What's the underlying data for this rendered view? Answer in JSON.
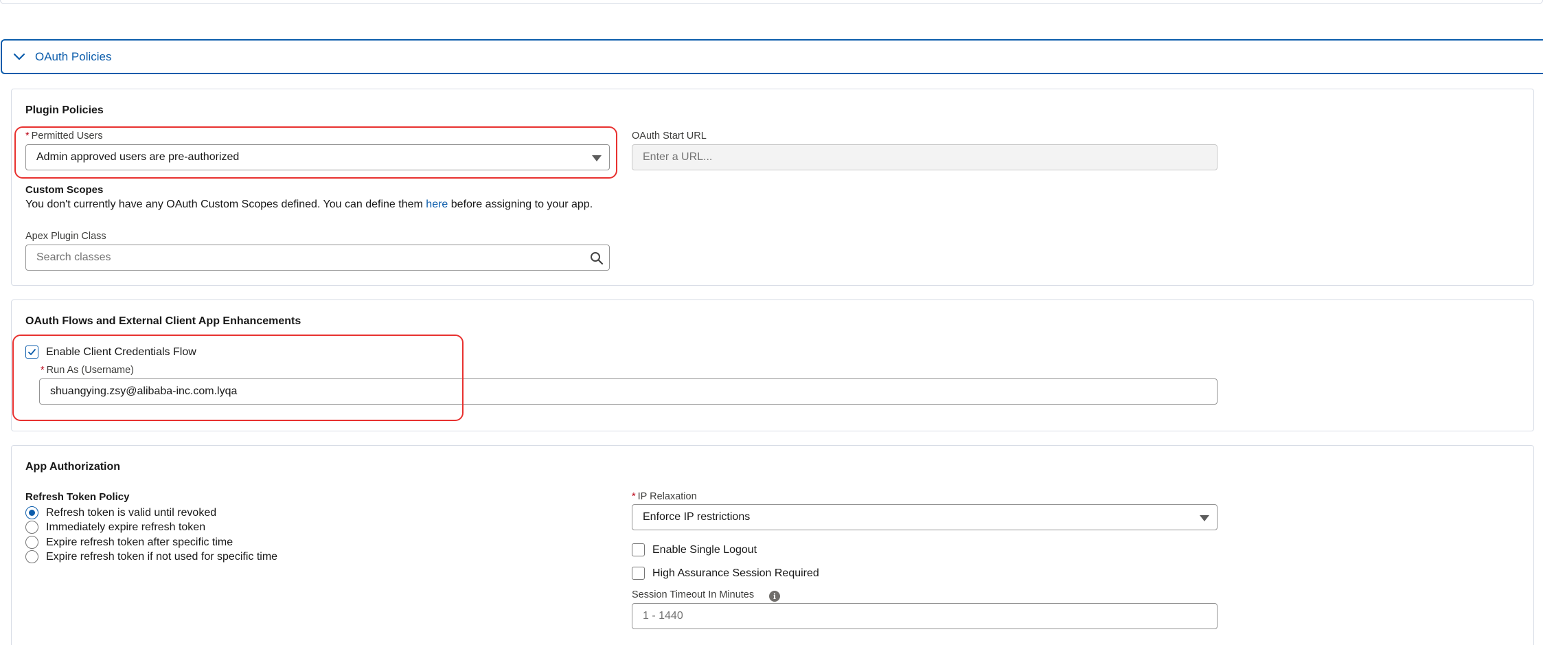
{
  "section": {
    "title": "OAuth Policies"
  },
  "plugin_policies": {
    "title": "Plugin Policies",
    "permitted_users": {
      "label": "Permitted Users",
      "value": "Admin approved users are pre-authorized"
    },
    "oauth_start_url": {
      "label": "OAuth Start URL",
      "placeholder": "Enter a URL..."
    },
    "custom_scopes": {
      "heading": "Custom Scopes",
      "text_before": "You don't currently have any OAuth Custom Scopes defined. You can define them ",
      "link": "here",
      "text_after": " before assigning to your app."
    },
    "apex_plugin_class": {
      "label": "Apex Plugin Class",
      "placeholder": "Search classes"
    }
  },
  "oauth_flows": {
    "title": "OAuth Flows and External Client App Enhancements",
    "client_credentials": {
      "label": "Enable Client Credentials Flow",
      "checked": true
    },
    "run_as": {
      "label": "Run As (Username)",
      "value": "shuangying.zsy@alibaba-inc.com.lyqa"
    }
  },
  "app_authorization": {
    "title": "App Authorization",
    "refresh_token_policy": {
      "label": "Refresh Token Policy",
      "options": [
        "Refresh token is valid until revoked",
        "Immediately expire refresh token",
        "Expire refresh token after specific time",
        "Expire refresh token if not used for specific time"
      ],
      "selected_index": 0
    },
    "ip_relaxation": {
      "label": "IP Relaxation",
      "value": "Enforce IP restrictions"
    },
    "single_logout": {
      "label": "Enable Single Logout",
      "checked": false
    },
    "high_assurance": {
      "label": "High Assurance Session Required",
      "checked": false
    },
    "session_timeout": {
      "label": "Session Timeout In Minutes",
      "placeholder": "1 - 1440"
    }
  },
  "colors": {
    "brand": "#0b5cab",
    "required": "#ba0517",
    "highlight": "#e8312f"
  }
}
